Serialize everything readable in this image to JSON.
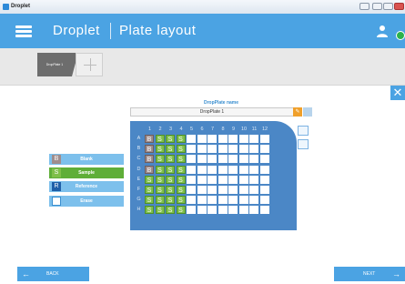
{
  "window": {
    "title": "Droplet"
  },
  "header": {
    "app_name": "Droplet",
    "page_title": "Plate layout"
  },
  "tabs": [
    {
      "label": "DropPlate 1"
    }
  ],
  "plate_name": {
    "label": "DropPlate name",
    "value": "DropPlate 1"
  },
  "plate": {
    "columns": [
      "1",
      "2",
      "3",
      "4",
      "5",
      "6",
      "7",
      "8",
      "9",
      "10",
      "11",
      "12"
    ],
    "rows": [
      "A",
      "B",
      "C",
      "D",
      "E",
      "F",
      "G",
      "H"
    ],
    "wells": [
      [
        "B",
        "S",
        "S",
        "S",
        "",
        "",
        "",
        "",
        "",
        "",
        "",
        ""
      ],
      [
        "B",
        "S",
        "S",
        "S",
        "",
        "",
        "",
        "",
        "",
        "",
        "",
        ""
      ],
      [
        "B",
        "S",
        "S",
        "S",
        "",
        "",
        "",
        "",
        "",
        "",
        "",
        ""
      ],
      [
        "B",
        "S",
        "S",
        "S",
        "",
        "",
        "",
        "",
        "",
        "",
        "",
        ""
      ],
      [
        "S",
        "S",
        "S",
        "S",
        "",
        "",
        "",
        "",
        "",
        "",
        "",
        ""
      ],
      [
        "S",
        "S",
        "S",
        "S",
        "",
        "",
        "",
        "",
        "",
        "",
        "",
        ""
      ],
      [
        "S",
        "S",
        "S",
        "S",
        "",
        "",
        "",
        "",
        "",
        "",
        "",
        ""
      ],
      [
        "S",
        "S",
        "S",
        "S",
        "",
        "",
        "",
        "",
        "",
        "",
        "",
        ""
      ]
    ]
  },
  "legend": [
    {
      "key": "B",
      "label": "Blank",
      "color": "#7dc0ec",
      "swatch": "#9f8d8d"
    },
    {
      "key": "S",
      "label": "Sample",
      "color": "#5fae38",
      "swatch": "#7fbf4a"
    },
    {
      "key": "R",
      "label": "Reference",
      "color": "#7dc0ec",
      "swatch": "#1f5fa8"
    },
    {
      "key": "",
      "label": "Erase",
      "color": "#7dc0ec",
      "swatch": "#ffffff"
    }
  ],
  "footer": {
    "back_label": "BACK",
    "next_label": "NEXT"
  },
  "colors": {
    "accent": "#4ba3e3",
    "plate": "#4b87c6",
    "sample": "#7fbf4a",
    "blank": "#9f8d8d"
  }
}
